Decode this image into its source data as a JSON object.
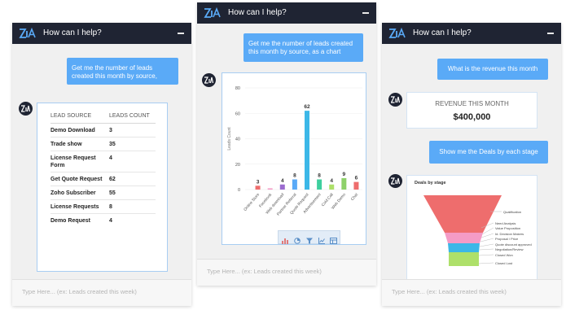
{
  "header": {
    "title": "How can I help?"
  },
  "input": {
    "placeholder": "Type Here... (ex: Leads created this week)"
  },
  "panel1": {
    "user_message": "Get me the number of leads created this month by source,",
    "table": {
      "headers": [
        "LEAD SOURCE",
        "LEADS COUNT"
      ],
      "rows": [
        [
          "Demo Download",
          "3"
        ],
        [
          "Trade show",
          "35"
        ],
        [
          "License Request Form",
          "4"
        ],
        [
          "Get Quote Request",
          "62"
        ],
        [
          "Zoho Subscriber",
          "55"
        ],
        [
          "License Requests",
          "8"
        ],
        [
          "Demo Request",
          "4"
        ]
      ]
    }
  },
  "panel2": {
    "user_message": "Get me the number of leads created this month by source, as a chart",
    "chart_icons": [
      "bar-chart-icon",
      "pie-chart-icon",
      "funnel-icon",
      "line-chart-icon",
      "table-icon"
    ]
  },
  "panel3": {
    "user_message_1": "What is the revenue this month",
    "revenue": {
      "label": "REVENUE THIS MONTH",
      "value": "$400,000"
    },
    "user_message_2": "Show me the Deals by each stage",
    "funnel": {
      "title": "Deals by stage",
      "stages": [
        "Qualification",
        "Need Analysis",
        "Value Proposition",
        "Id. Decision Makers",
        "Proposal / Price",
        "Quote discount approved",
        "Negotiation/Review",
        "Closed Won",
        "Closed Lost"
      ],
      "colors": [
        "#ee6d6d",
        "#f49bc6",
        "#3cb7e7",
        "#aee06a"
      ]
    }
  },
  "chart_data": {
    "type": "bar",
    "categories": [
      "Online Store",
      "Facebook",
      "Web download",
      "Partner Referral",
      "Quote Request",
      "Advertisement",
      "Cold Call",
      "Web Demo",
      "Chat"
    ],
    "values": [
      3,
      1,
      4,
      8,
      62,
      8,
      4,
      9,
      6
    ],
    "labels": [
      "3",
      "",
      "4",
      "8",
      "62",
      "8",
      "4",
      "9",
      "6"
    ],
    "colors": [
      "#ee6d6d",
      "#f49bc6",
      "#9b6bcf",
      "#5aaaf7",
      "#3cb7e7",
      "#3ecf9e",
      "#aee06a",
      "#8ed16a",
      "#ee6d6d"
    ],
    "ylabel": "Leads Count",
    "yticks": [
      0,
      20,
      40,
      60,
      80
    ],
    "ylim": [
      0,
      80
    ],
    "grid": true
  }
}
